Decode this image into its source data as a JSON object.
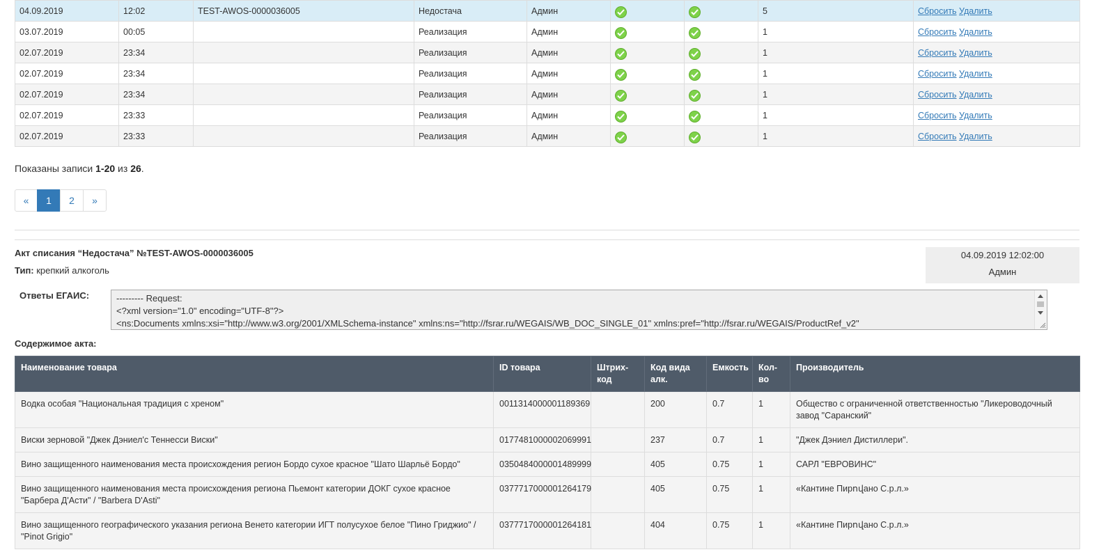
{
  "records": [
    {
      "date": "04.09.2019",
      "time": "12:02",
      "number": "TEST-AWOS-0000036005",
      "type": "Недостача",
      "user": "Админ",
      "count": "5",
      "selected": true
    },
    {
      "date": "03.07.2019",
      "time": "00:05",
      "number": "",
      "type": "Реализация",
      "user": "Админ",
      "count": "1"
    },
    {
      "date": "02.07.2019",
      "time": "23:34",
      "number": "",
      "type": "Реализация",
      "user": "Админ",
      "count": "1"
    },
    {
      "date": "02.07.2019",
      "time": "23:34",
      "number": "",
      "type": "Реализация",
      "user": "Админ",
      "count": "1"
    },
    {
      "date": "02.07.2019",
      "time": "23:34",
      "number": "",
      "type": "Реализация",
      "user": "Админ",
      "count": "1"
    },
    {
      "date": "02.07.2019",
      "time": "23:33",
      "number": "",
      "type": "Реализация",
      "user": "Админ",
      "count": "1"
    },
    {
      "date": "02.07.2019",
      "time": "23:33",
      "number": "",
      "type": "Реализация",
      "user": "Админ",
      "count": "1"
    }
  ],
  "actions": {
    "reset": "Сбросить",
    "delete": "Удалить"
  },
  "summary": {
    "prefix": "Показаны записи ",
    "range": "1-20",
    "middle": " из ",
    "total": "26",
    "suffix": "."
  },
  "pagination": {
    "prev": "«",
    "pages": [
      "1",
      "2"
    ],
    "active": "1",
    "next": "»"
  },
  "act": {
    "title": "Акт списания “Недостача” №TEST-AWOS-0000036005",
    "type_label": "Тип:",
    "type_value": " крепкий алкоголь",
    "datetime": "04.09.2019 12:02:00",
    "user": "Админ",
    "egais_label": "Ответы ЕГАИС:",
    "egais_text": "--------- Request:\n<?xml version=\"1.0\" encoding=\"UTF-8\"?>\n<ns:Documents xmlns:xsi=\"http://www.w3.org/2001/XMLSchema-instance\" xmlns:ns=\"http://fsrar.ru/WEGAIS/WB_DOC_SINGLE_01\" xmlns:pref=\"http://fsrar.ru/WEGAIS/ProductRef_v2\"",
    "contents_label": "Содержимое акта:"
  },
  "items_table": {
    "headers": [
      "Наименование товара",
      "ID товара",
      "Штрих-код",
      "Код вида алк.",
      "Емкость",
      "Кол-во",
      "Производитель"
    ],
    "rows": [
      [
        "Водка особая \"Национальная традиция с хреном\"",
        "0011314000001189369",
        "",
        "200",
        "0.7",
        "1",
        "Общество с ограниченной ответственностью \"Ликероводочный завод \"Саранский\""
      ],
      [
        "Виски зерновой \"Джек Дэниел'с Теннесси Виски\"",
        "0177481000002069991",
        "",
        "237",
        "0.7",
        "1",
        "\"Джек Дэниел Дистиллери\"."
      ],
      [
        "Вино защищенного наименования места происхождения регион Бордо сухое красное \"Шато Шарльё Бордо\"",
        "0350484000001489999",
        "",
        "405",
        "0.75",
        "1",
        "САРЛ \"ЕВРОВИНС\""
      ],
      [
        "Вино защищенного наименования места происхождения региона Пьемонт категории ДОКГ сухое красное \"Барбера Д'Асти\" / \"Barbera D'Asti\"",
        "0377717000001264179",
        "",
        "405",
        "0.75",
        "1",
        "«Кантине Пирովано С.р.л.»"
      ],
      [
        "Вино защищенного географического указания региона Венето категории ИГТ полусухое белое \"Пино Гриджио\" / \"Pinot Grigio\"",
        "0377717000001264181",
        "",
        "404",
        "0.75",
        "1",
        "«Кантине Пирովано С.р.л.»"
      ]
    ]
  },
  "colors": {
    "accent": "#337ab7",
    "header_bg": "#4f5b69",
    "check": "#7ed24a",
    "selected_row": "#d9edf7"
  },
  "icons": {
    "status": "check-circle-icon"
  }
}
